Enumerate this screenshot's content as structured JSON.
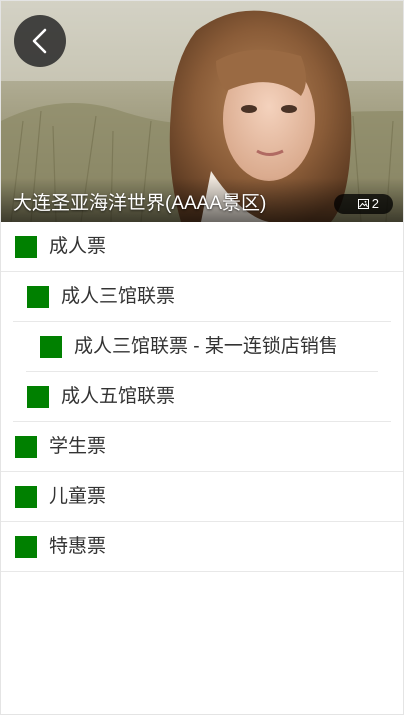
{
  "hero": {
    "title": "大连圣亚海洋世界(AAAA景区)",
    "photo_count": "2",
    "back_icon": "chevron-left-icon",
    "photo_icon": "picture-icon",
    "overlay_color": "#000000"
  },
  "colors": {
    "swatch": "#008000",
    "text": "#333333",
    "divider": "#e8e8e8"
  },
  "tickets": [
    {
      "label": "成人票",
      "level": 0
    },
    {
      "label": "成人三馆联票",
      "level": 1
    },
    {
      "label": "成人三馆联票 - 某一连锁店销售",
      "level": 2
    },
    {
      "label": "成人五馆联票",
      "level": 1
    },
    {
      "label": "学生票",
      "level": 0
    },
    {
      "label": "儿童票",
      "level": 0
    },
    {
      "label": "特惠票",
      "level": 0
    }
  ]
}
